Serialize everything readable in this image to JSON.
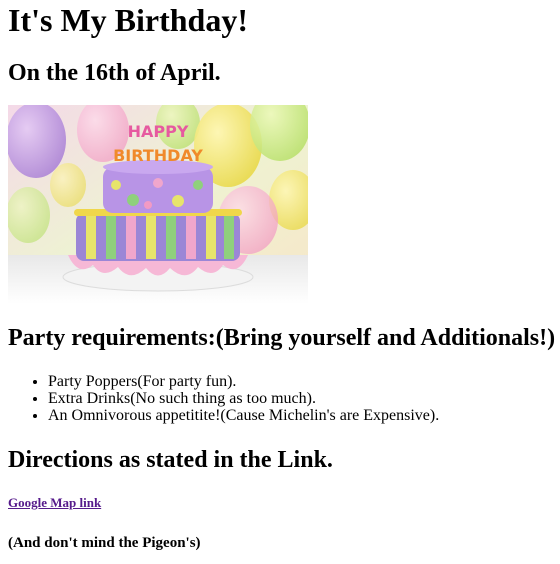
{
  "page": {
    "title": "It's My Birthday!",
    "date_heading": "On the 16th of April.",
    "cake_image_topper_text": "HAPPY BIRTHDAY",
    "requirements_heading": "Party requirements:(Bring yourself and Additionals!)",
    "requirements": [
      "Party Poppers(For party fun).",
      "Extra Drinks(No such thing as too much).",
      "An Omnivorous appetitite!(Cause Michelin's are Expensive)."
    ],
    "directions_heading": "Directions as stated in the Link.",
    "map_link_label": "Google Map link",
    "footnote": "(And don't mind the Pigeon's)"
  },
  "colors": {
    "link_visited": "#551a8b",
    "text": "#000000",
    "background": "#ffffff"
  }
}
